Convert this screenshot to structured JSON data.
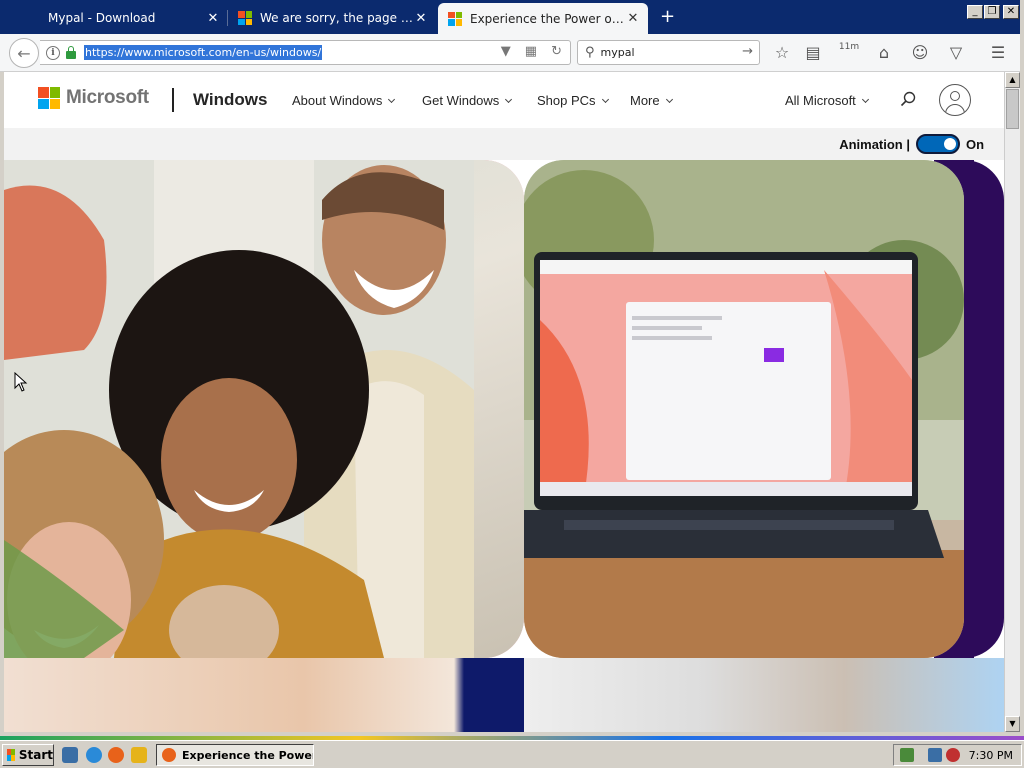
{
  "browser": {
    "tabs": [
      {
        "title": "Mypal - Download",
        "active": false,
        "favicon": "none"
      },
      {
        "title": "We are sorry, the page you r…",
        "active": false,
        "favicon": "microsoft-icon"
      },
      {
        "title": "Experience the Power of Win…",
        "active": true,
        "favicon": "microsoft-icon"
      }
    ],
    "new_tab_label": "+",
    "close_glyph": "✕",
    "url": "https://www.microsoft.com/en-us/windows/",
    "search_value": "mypal",
    "window_controls": [
      "_",
      "❐",
      "✕"
    ],
    "toolbar_icons": [
      "star-icon",
      "reading-list-icon",
      "timer-icon",
      "home-icon",
      "chat-icon",
      "pocket-icon",
      "menu-icon"
    ],
    "timer_badge": "11m"
  },
  "page": {
    "header": {
      "brand": "Microsoft",
      "product": "Windows",
      "nav": [
        "About Windows",
        "Get Windows",
        "Shop PCs",
        "More"
      ],
      "all_microsoft": "All Microsoft"
    },
    "animation": {
      "label": "Animation |",
      "state": "On"
    },
    "colors": {
      "ms_red": "#f25022",
      "ms_green": "#7fba00",
      "ms_blue": "#00a4ef",
      "ms_yellow": "#ffb900",
      "toggle": "#0067b8",
      "pink_band": "#f5a5b8",
      "purple_band": "#2d0b5a"
    }
  },
  "taskbar": {
    "start_label": "Start",
    "task_button": "Experience the Power...",
    "clock": "7:30 PM"
  }
}
